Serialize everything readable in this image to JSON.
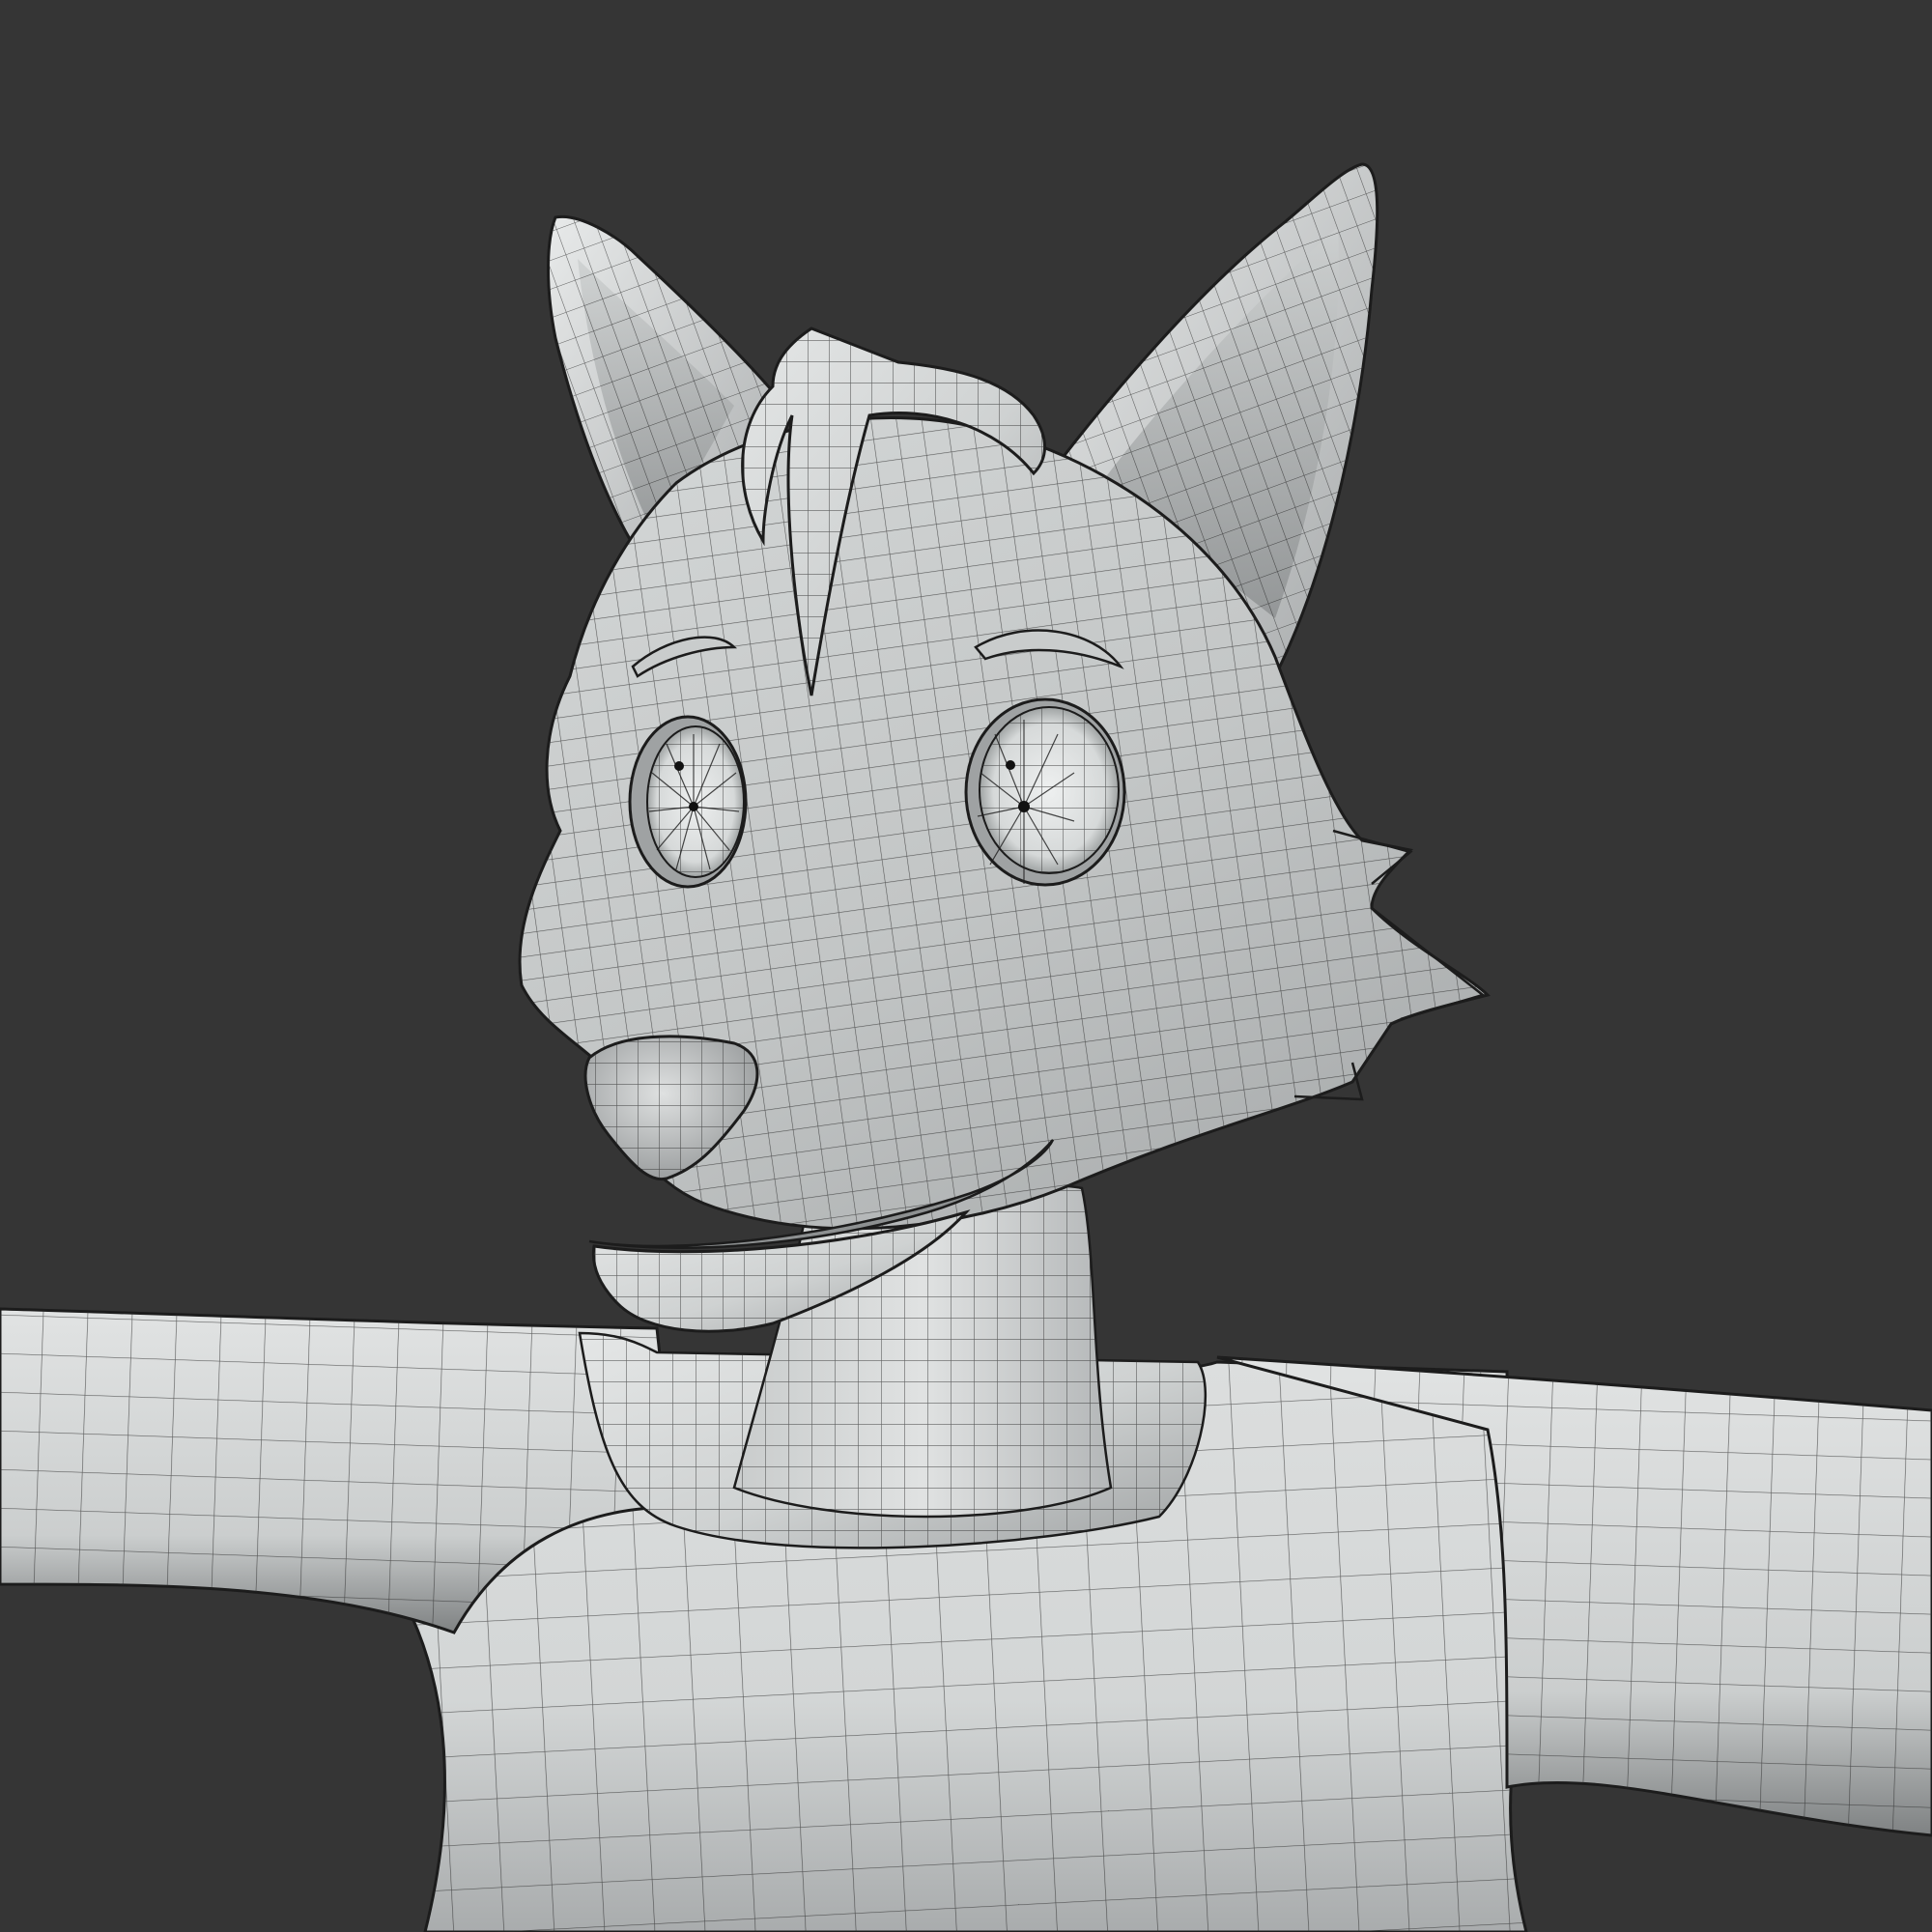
{
  "scene": {
    "subject": "fox-character-model",
    "shading": "solid",
    "overlay": "wireframe",
    "colors": {
      "background": "#353535",
      "surface_light": "#dfe1e1",
      "surface_mid": "#b9bcbc",
      "surface_dark": "#7c7f80",
      "wire": "#2a2a2a",
      "outline": "#1c1c1c"
    }
  }
}
